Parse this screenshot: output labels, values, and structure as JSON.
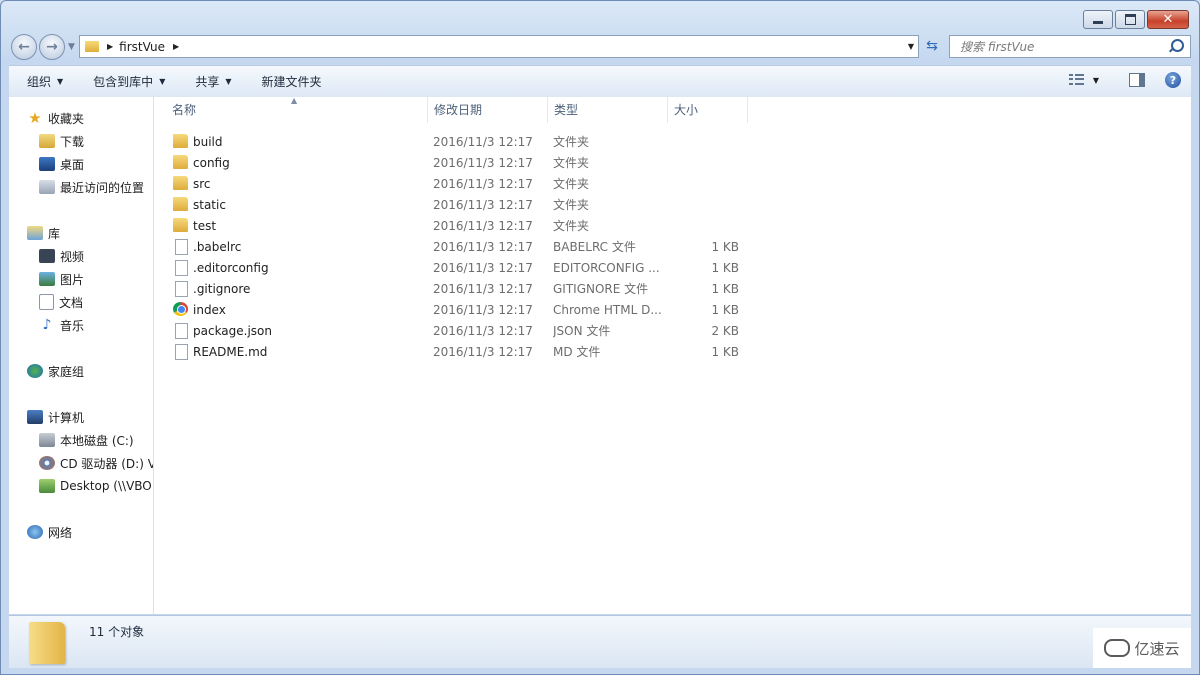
{
  "window": {
    "min": "",
    "max": "",
    "close": "✕"
  },
  "address": {
    "crumb": "firstVue"
  },
  "search": {
    "placeholder": "搜索 firstVue"
  },
  "toolbar": {
    "organize": "组织",
    "include_library": "包含到库中",
    "share": "共享",
    "new_folder": "新建文件夹"
  },
  "nav": {
    "favorites": "收藏夹",
    "downloads": "下载",
    "desktop": "桌面",
    "recent": "最近访问的位置",
    "libraries": "库",
    "videos": "视频",
    "pictures": "图片",
    "documents": "文档",
    "music": "音乐",
    "homegroup": "家庭组",
    "computer": "计算机",
    "local_disk": "本地磁盘 (C:)",
    "cd_drive": "CD 驱动器 (D:) V",
    "desktop_share": "Desktop (\\\\VBO",
    "network": "网络"
  },
  "columns": {
    "name": "名称",
    "date": "修改日期",
    "type": "类型",
    "size": "大小"
  },
  "files": [
    {
      "name": "build",
      "date": "2016/11/3 12:17",
      "type": "文件夹",
      "size": "",
      "icon": "folder"
    },
    {
      "name": "config",
      "date": "2016/11/3 12:17",
      "type": "文件夹",
      "size": "",
      "icon": "folder"
    },
    {
      "name": "src",
      "date": "2016/11/3 12:17",
      "type": "文件夹",
      "size": "",
      "icon": "folder"
    },
    {
      "name": "static",
      "date": "2016/11/3 12:17",
      "type": "文件夹",
      "size": "",
      "icon": "folder"
    },
    {
      "name": "test",
      "date": "2016/11/3 12:17",
      "type": "文件夹",
      "size": "",
      "icon": "folder"
    },
    {
      "name": ".babelrc",
      "date": "2016/11/3 12:17",
      "type": "BABELRC 文件",
      "size": "1 KB",
      "icon": "file"
    },
    {
      "name": ".editorconfig",
      "date": "2016/11/3 12:17",
      "type": "EDITORCONFIG ...",
      "size": "1 KB",
      "icon": "file"
    },
    {
      "name": ".gitignore",
      "date": "2016/11/3 12:17",
      "type": "GITIGNORE 文件",
      "size": "1 KB",
      "icon": "file"
    },
    {
      "name": "index",
      "date": "2016/11/3 12:17",
      "type": "Chrome HTML D...",
      "size": "1 KB",
      "icon": "chrome"
    },
    {
      "name": "package.json",
      "date": "2016/11/3 12:17",
      "type": "JSON 文件",
      "size": "2 KB",
      "icon": "file"
    },
    {
      "name": "README.md",
      "date": "2016/11/3 12:17",
      "type": "MD 文件",
      "size": "1 KB",
      "icon": "file"
    }
  ],
  "details": {
    "count": "11 个对象"
  },
  "watermark": {
    "text": "亿速云"
  }
}
